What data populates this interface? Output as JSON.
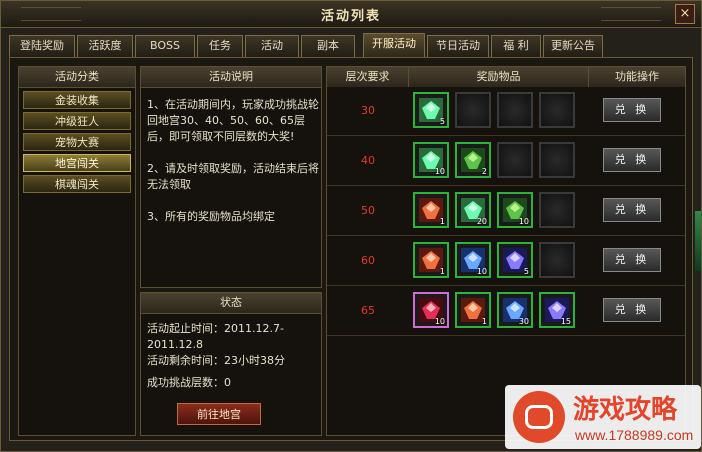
{
  "window": {
    "title": "活动列表",
    "close_label": "×"
  },
  "tabs": [
    {
      "label": "登陆奖励"
    },
    {
      "label": "活跃度"
    },
    {
      "label": "BOSS"
    },
    {
      "label": "任务"
    },
    {
      "label": "活动"
    },
    {
      "label": "副本"
    },
    {
      "label": "开服活动",
      "active": true
    },
    {
      "label": "节日活动"
    },
    {
      "label": "福 利"
    },
    {
      "label": "更新公告"
    }
  ],
  "categories": {
    "header": "活动分类",
    "items": [
      {
        "label": "金装收集"
      },
      {
        "label": "冲级狂人"
      },
      {
        "label": "宠物大赛"
      },
      {
        "label": "地宫闯关",
        "active": true
      },
      {
        "label": "棋魂闯关"
      }
    ]
  },
  "description": {
    "header": "活动说明",
    "text": "1、在活动期间内，玩家成功挑战轮回地宫30、40、50、60、65层后，即可领取不同层数的大奖!\n\n2、请及时领取奖励，活动结束后将无法领取\n\n3、所有的奖励物品均绑定"
  },
  "status": {
    "header": "状态",
    "start_line1": "活动起止时间：2011.12.7-",
    "start_line2": "2011.12.8",
    "remaining": "活动剩余时间：23小时38分",
    "floors": "成功挑战层数：0",
    "go_button": "前往地宫"
  },
  "rewards": {
    "headers": {
      "level": "层次要求",
      "items": "奖励物品",
      "action": "功能操作"
    },
    "exchange_label": "兑 换",
    "rows": [
      {
        "level": "30",
        "items": [
          {
            "icon": "green-gem-icon",
            "count": "5",
            "border": "green"
          },
          {
            "icon": "empty-slot"
          },
          {
            "icon": "empty-slot"
          },
          {
            "icon": "empty-slot"
          }
        ]
      },
      {
        "level": "40",
        "items": [
          {
            "icon": "green-gem-icon",
            "count": "10",
            "border": "green"
          },
          {
            "icon": "green-leaf-icon",
            "count": "2",
            "border": "green"
          },
          {
            "icon": "empty-slot"
          },
          {
            "icon": "empty-slot"
          }
        ]
      },
      {
        "level": "50",
        "items": [
          {
            "icon": "red-gem-icon",
            "count": "1",
            "border": "green"
          },
          {
            "icon": "green-gem-icon",
            "count": "20",
            "border": "green"
          },
          {
            "icon": "green-leaf-icon",
            "count": "10",
            "border": "green"
          },
          {
            "icon": "empty-slot"
          }
        ]
      },
      {
        "level": "60",
        "items": [
          {
            "icon": "red-gem-icon",
            "count": "1",
            "border": "green"
          },
          {
            "icon": "blue-gem-icon",
            "count": "10",
            "border": "green"
          },
          {
            "icon": "blue-crystal-icon",
            "count": "5",
            "border": "green"
          },
          {
            "icon": "empty-slot"
          }
        ]
      },
      {
        "level": "65",
        "items": [
          {
            "icon": "red-orb-icon",
            "count": "10",
            "border": "purple"
          },
          {
            "icon": "red-gem-icon",
            "count": "1",
            "border": "green"
          },
          {
            "icon": "blue-gem-icon",
            "count": "30",
            "border": "green"
          },
          {
            "icon": "blue-crystal-icon",
            "count": "15",
            "border": "green"
          }
        ]
      }
    ]
  },
  "watermark": {
    "title": "游戏攻略",
    "url": "www.1788989.com"
  },
  "colors": {
    "level_text": "#e23a2a",
    "accent": "#7e6b43",
    "green_border": "#2fb23a",
    "purple_border": "#d26bd8"
  }
}
